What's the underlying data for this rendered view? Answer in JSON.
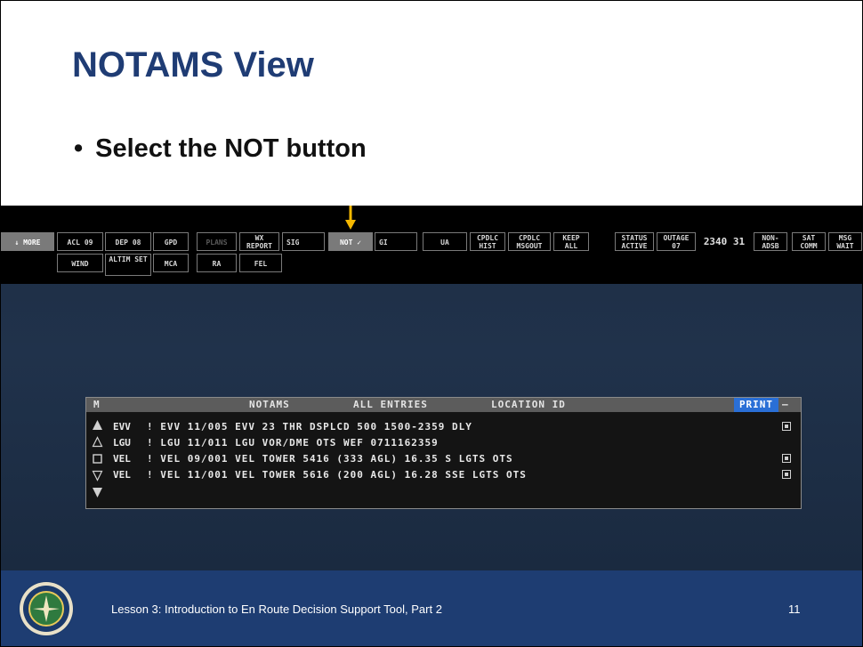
{
  "slide": {
    "title": "NOTAMS View",
    "bullet": "Select the NOT button"
  },
  "toolbar": {
    "row1": [
      {
        "label": "↓ MORE",
        "state": "active"
      },
      {
        "label": "ACL 09",
        "state": "normal"
      },
      {
        "label": "DEP 08",
        "state": "normal"
      },
      {
        "label": "GPD",
        "state": "normal"
      },
      {
        "label": "PLANS",
        "state": "disabled"
      },
      {
        "label": "WX REPORT",
        "state": "normal"
      },
      {
        "label": "SIG",
        "state": "normal"
      },
      {
        "label": "NOT ✓",
        "state": "active"
      },
      {
        "label": "GI",
        "state": "normal"
      },
      {
        "label": "UA",
        "state": "normal"
      },
      {
        "label": "CPDLC HIST",
        "state": "normal"
      },
      {
        "label": "CPDLC MSGOUT",
        "state": "normal"
      },
      {
        "label": "KEEP ALL",
        "state": "normal"
      },
      {
        "label": "STATUS ACTIVE",
        "state": "normal"
      },
      {
        "label": "OUTAGE 07",
        "state": "normal"
      },
      {
        "label": "2340 31",
        "state": "text"
      },
      {
        "label": "NON- ADSB",
        "state": "normal"
      },
      {
        "label": "SAT COMM",
        "state": "normal"
      },
      {
        "label": "MSG WAIT",
        "state": "normal"
      }
    ],
    "row2": [
      {
        "label": "WIND"
      },
      {
        "label": "ALTIM SET"
      },
      {
        "label": "MCA"
      },
      {
        "label": "RA"
      },
      {
        "label": "FEL"
      }
    ]
  },
  "notams_panel": {
    "menu": "M",
    "title": "NOTAMS",
    "filter": "ALL ENTRIES",
    "sort": "LOCATION ID",
    "print_label": "PRINT",
    "minimize": "–",
    "rows": [
      {
        "location": "EVV",
        "text": "! EVV 11/005 EVV 23 THR DSPLCD 500 1500-2359 DLY",
        "flag": true
      },
      {
        "location": "LGU",
        "text": "! LGU 11/011 LGU VOR/DME OTS WEF 0711162359",
        "flag": false
      },
      {
        "location": "VEL",
        "text": "! VEL 09/001 VEL TOWER 5416 (333 AGL) 16.35 S LGTS OTS",
        "flag": true
      },
      {
        "location": "VEL",
        "text": "! VEL 11/001 VEL TOWER 5616 (200 AGL) 16.28 SSE LGTS OTS",
        "flag": true
      }
    ]
  },
  "footer": {
    "lesson": "Lesson 3: Introduction to En Route Decision Support Tool, Part 2",
    "page": "11"
  },
  "colors": {
    "title": "#1f3c74",
    "footer_bg": "#1e3d72",
    "print_button": "#2a6fd6",
    "arrow": "#f5b800"
  }
}
